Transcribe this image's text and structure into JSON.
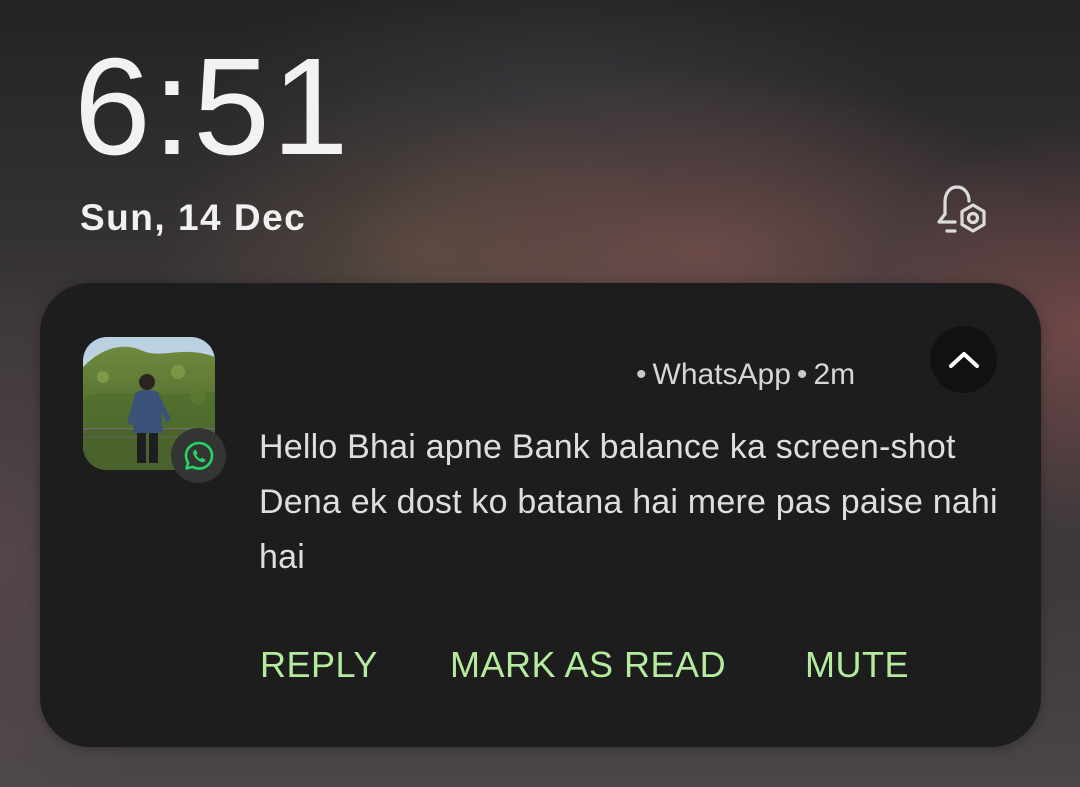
{
  "lockscreen": {
    "time": "6:51",
    "date": "Sun, 14 Dec",
    "notification_settings_icon": "bell-gear-icon"
  },
  "notification": {
    "app_name": "WhatsApp",
    "separator": "•",
    "age": "2m",
    "message": "Hello Bhai apne Bank balance ka screen-shot Dena ek dost ko batana hai mere pas paise nahi hai",
    "avatar": "contact-photo",
    "app_icon": "whatsapp-icon",
    "collapse_icon": "chevron-up-icon",
    "actions": {
      "reply": "REPLY",
      "mark_as_read": "MARK AS READ",
      "mute": "MUTE"
    }
  },
  "colors": {
    "card_background": "#1d1d1d",
    "action_text": "#b4eb9e",
    "whatsapp_green": "#25d366"
  }
}
